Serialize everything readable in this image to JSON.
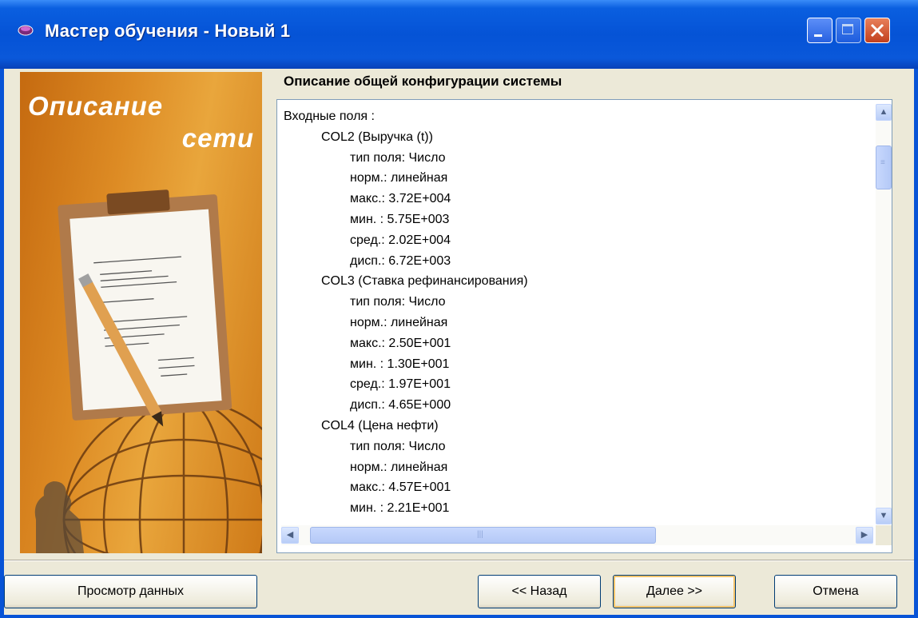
{
  "window": {
    "title": "Мастер обучения - Новый 1",
    "controls": [
      "minimize",
      "maximize",
      "close"
    ]
  },
  "side_image": {
    "title_line1": "Описание",
    "title_line2": "сети"
  },
  "panel": {
    "heading": "Описание общей конфигурации системы",
    "lines": [
      {
        "level": 0,
        "text": "Входные поля :"
      },
      {
        "level": 1,
        "text": "COL2 (Выручка (t))"
      },
      {
        "level": 2,
        "text": "тип поля: Число"
      },
      {
        "level": 2,
        "text": "норм.: линейная"
      },
      {
        "level": 2,
        "text": "макс.: 3.72E+004"
      },
      {
        "level": 2,
        "text": "мин. : 5.75E+003"
      },
      {
        "level": 2,
        "text": "сред.: 2.02E+004"
      },
      {
        "level": 2,
        "text": "дисп.: 6.72E+003"
      },
      {
        "level": 1,
        "text": "COL3 (Ставка рефинансирования)"
      },
      {
        "level": 2,
        "text": "тип поля: Число"
      },
      {
        "level": 2,
        "text": "норм.: линейная"
      },
      {
        "level": 2,
        "text": "макс.: 2.50E+001"
      },
      {
        "level": 2,
        "text": "мин. : 1.30E+001"
      },
      {
        "level": 2,
        "text": "сред.: 1.97E+001"
      },
      {
        "level": 2,
        "text": "дисп.: 4.65E+000"
      },
      {
        "level": 1,
        "text": "COL4 (Цена нефти)"
      },
      {
        "level": 2,
        "text": "тип поля: Число"
      },
      {
        "level": 2,
        "text": "норм.: линейная"
      },
      {
        "level": 2,
        "text": "макс.: 4.57E+001"
      },
      {
        "level": 2,
        "text": "мин. : 2.21E+001"
      }
    ]
  },
  "buttons": {
    "view_data": "Просмотр данных",
    "back": "<< Назад",
    "next": "Далее >>",
    "cancel": "Отмена"
  },
  "colors": {
    "titlebar": "#0553d6",
    "dialog_bg": "#ece9d8",
    "side_image_orange": "#dd8b24",
    "default_button_highlight": "#f6c46a"
  },
  "icons": [
    "app-icon",
    "minimize-icon",
    "maximize-icon",
    "close-icon",
    "scroll-up-icon",
    "scroll-down-icon",
    "scroll-left-icon",
    "scroll-right-icon"
  ]
}
